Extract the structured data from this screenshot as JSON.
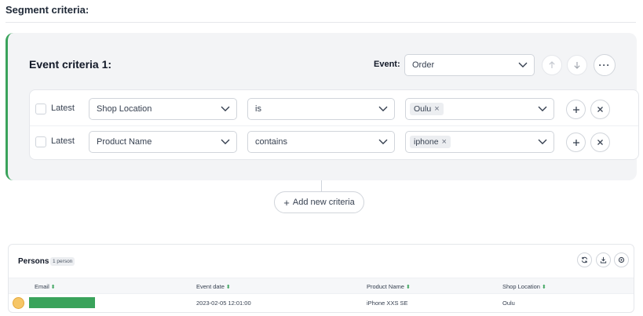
{
  "segment": {
    "title": "Segment criteria:"
  },
  "event_criteria": {
    "title": "Event criteria 1:",
    "event_label": "Event:",
    "event_value": "Order",
    "more_label": "···",
    "rows": [
      {
        "checkbox_label": "Latest",
        "field": "Shop Location",
        "operator": "is",
        "value_chip": "Oulu"
      },
      {
        "checkbox_label": "Latest",
        "field": "Product Name",
        "operator": "contains",
        "value_chip": "iphone"
      }
    ]
  },
  "add_button": {
    "label": "Add new criteria"
  },
  "persons": {
    "title": "Persons",
    "count_badge": "1 person",
    "columns": [
      "Email",
      "Event date",
      "Product Name",
      "Shop Location"
    ],
    "rows": [
      {
        "event_date": "2023-02-05 12:01:00",
        "product_name": "iPhone XXS SE",
        "shop_location": "Oulu"
      }
    ]
  },
  "colors": {
    "accent": "#3aa35b",
    "card_bg": "#f3f4f6",
    "border": "#d1d5db"
  }
}
